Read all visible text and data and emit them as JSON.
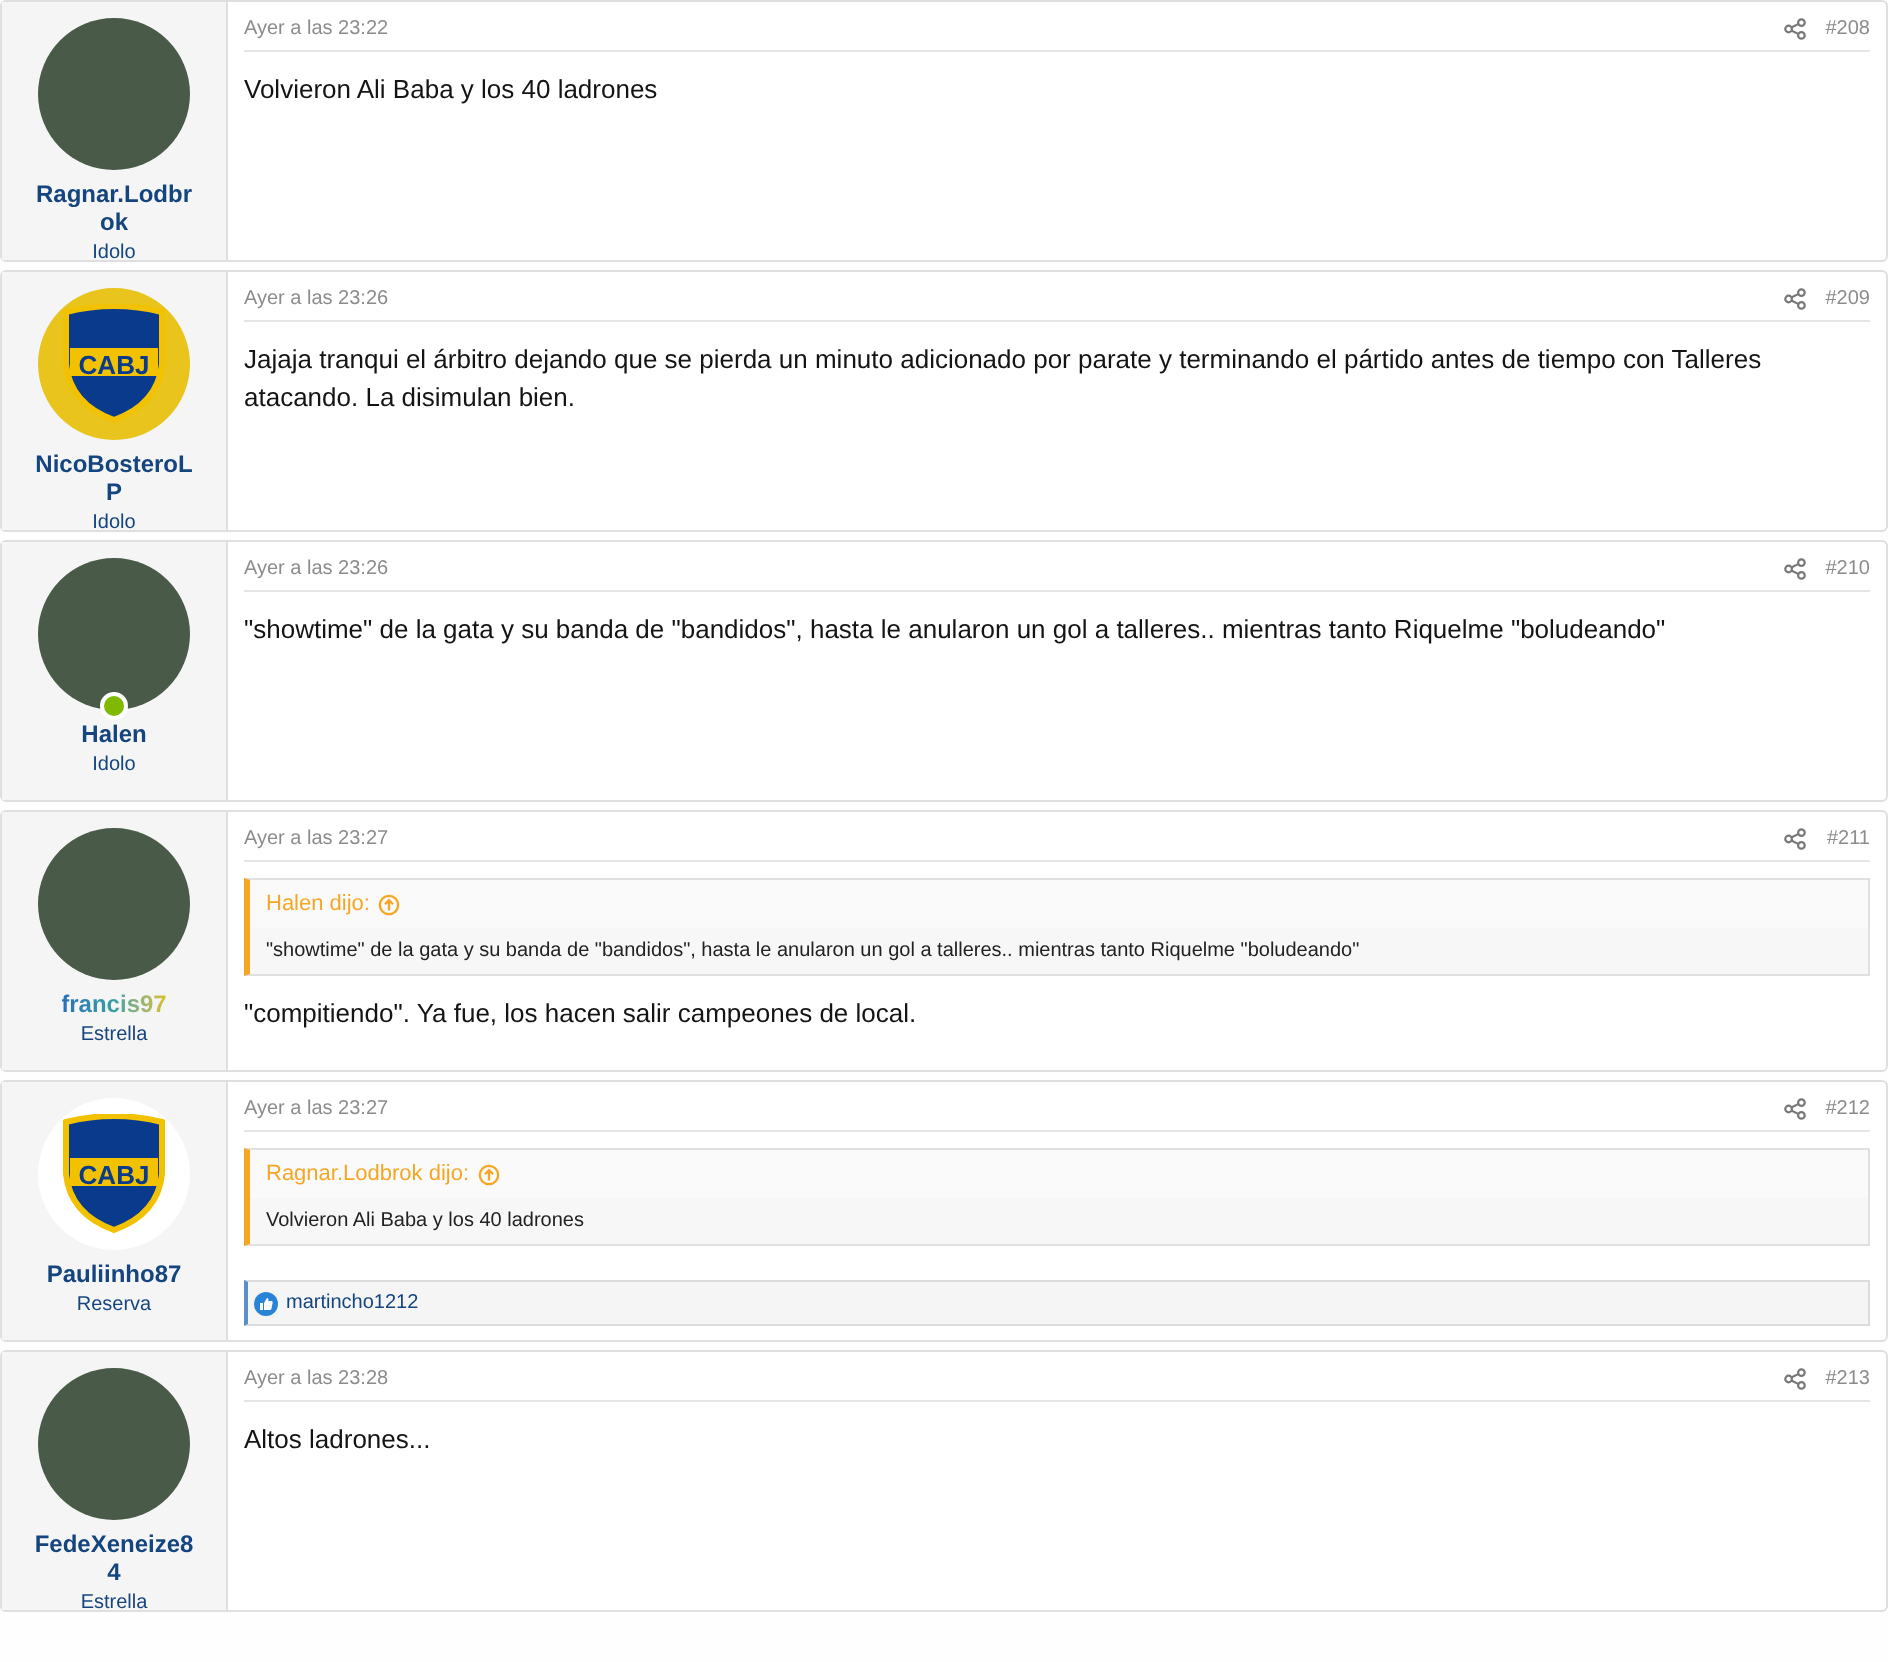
{
  "posts": [
    {
      "author": "Ragnar.Lodbrok",
      "kind": "plain",
      "role": "Idolo",
      "avatar": {
        "kind": "photo"
      },
      "online": false,
      "time": "Ayer a las 23:22",
      "number": "#208",
      "body": "Volvieron Ali Baba y los 40 ladrones"
    },
    {
      "author": "NicoBosteroLP",
      "kind": "plain",
      "role": "Idolo",
      "avatar": {
        "kind": "crest-yellow",
        "text": "CABJ"
      },
      "online": false,
      "time": "Ayer a las 23:26",
      "number": "#209",
      "body": "Jajaja tranqui el árbitro dejando que se pierda un minuto adicionado por parate y terminando el pártido antes de tiempo con Talleres atacando. La disimulan bien."
    },
    {
      "author": "Halen",
      "kind": "plain",
      "role": "Idolo",
      "avatar": {
        "kind": "photo"
      },
      "online": true,
      "time": "Ayer a las 23:26",
      "number": "#210",
      "body": "\"showtime\" de la gata y su banda de \"bandidos\", hasta le anularon un gol a talleres.. mientras tanto Riquelme \"boludeando\""
    },
    {
      "author": "francis97",
      "kind": "gradient",
      "role": "Estrella",
      "avatar": {
        "kind": "photo"
      },
      "online": false,
      "time": "Ayer a las 23:27",
      "number": "#211",
      "quote": {
        "title": "Halen dijo:",
        "text": "\"showtime\" de la gata y su banda de \"bandidos\", hasta le anularon un gol a talleres.. mientras tanto Riquelme \"boludeando\""
      },
      "body": "\"compitiendo\". Ya fue, los hacen salir campeones de local."
    },
    {
      "author": "Pauliinho87",
      "kind": "plain",
      "role": "Reserva",
      "avatar": {
        "kind": "crest-white",
        "text": "CABJ"
      },
      "online": false,
      "time": "Ayer a las 23:27",
      "number": "#212",
      "quote": {
        "title": "Ragnar.Lodbrok dijo:",
        "text": "Volvieron Ali Baba y los 40 ladrones"
      },
      "reactions": "martincho1212"
    },
    {
      "author": "FedeXeneize84",
      "kind": "plain",
      "role": "Estrella",
      "avatar": {
        "kind": "photo"
      },
      "online": false,
      "time": "Ayer a las 23:28",
      "number": "#213",
      "body": "Altos ladrones..."
    }
  ]
}
